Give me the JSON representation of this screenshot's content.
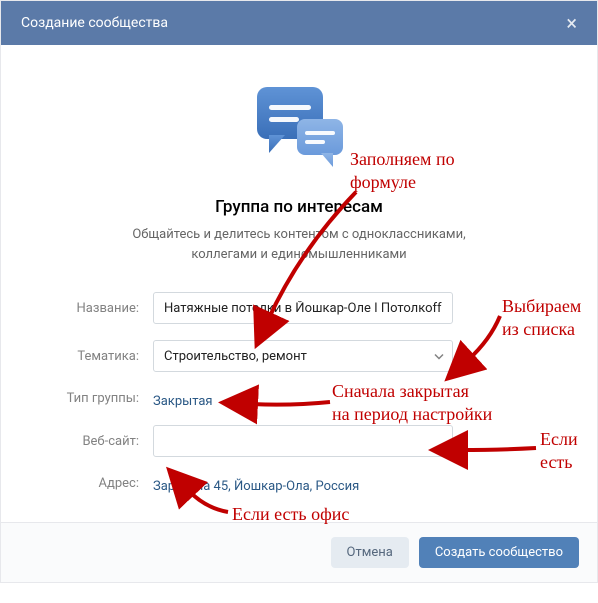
{
  "header": {
    "title": "Создание сообщества"
  },
  "content": {
    "heading": "Группа по интересам",
    "subheading_line1": "Общайтесь и делитесь контентом с одноклассниками,",
    "subheading_line2": "коллегами и единомышленниками"
  },
  "form": {
    "name": {
      "label": "Название:",
      "value": "Натяжные потолки в Йошкар-Оле I Потолкоff"
    },
    "topic": {
      "label": "Тематика:",
      "value": "Строительство, ремонт"
    },
    "group_type": {
      "label": "Тип группы:",
      "value": "Закрытая"
    },
    "website": {
      "label": "Веб-сайт:",
      "value": ""
    },
    "address": {
      "label": "Адрес:",
      "value": "Зарубина 45, Йошкар-Ола, Россия"
    }
  },
  "footer": {
    "cancel": "Отмена",
    "create": "Создать сообщество"
  },
  "annotations": {
    "a1": "Заполняем по\nформуле",
    "a2": "Выбираем\nиз списка",
    "a3": "Сначала закрытая\nна период настройки",
    "a4": "Если\nесть",
    "a5": "Если есть офис"
  },
  "colors": {
    "header_bg": "#5b7aa8",
    "primary_btn": "#5181b8",
    "link": "#2a5885",
    "annotation": "#c00000"
  }
}
